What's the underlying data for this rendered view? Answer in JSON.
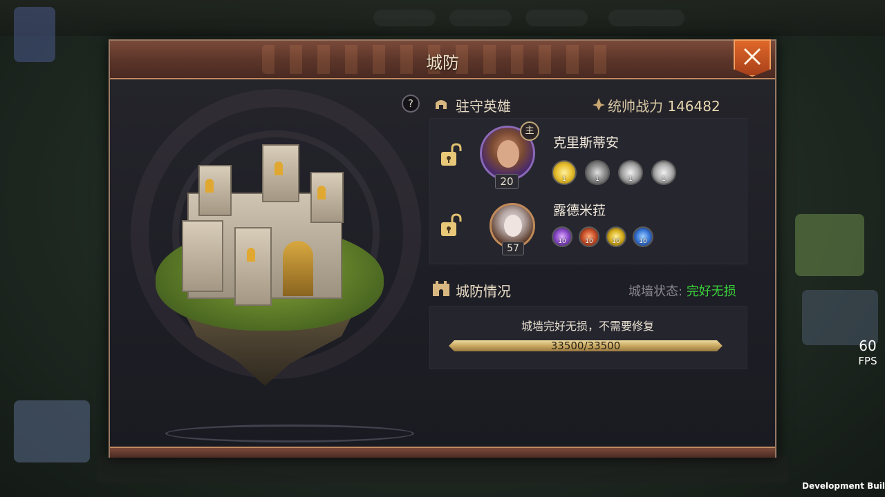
{
  "colors": {
    "accent_orange": "#e0682a",
    "status_green": "#3ad43a",
    "main_hero_frame": "#8a6ab8",
    "hp_gold": "#c8a860"
  },
  "modal": {
    "title": "城防",
    "close_icon": "close-x-icon"
  },
  "garrison": {
    "help_label": "?",
    "title": "驻守英雄",
    "power_label": "统帅战力",
    "power_value": "146482",
    "heroes": [
      {
        "name": "克里斯蒂安",
        "level": "20",
        "main_badge": "主",
        "skills": [
          {
            "icon": "sun-skill-icon",
            "level": "1",
            "color": "#e8c030"
          },
          {
            "icon": "wolf-skill-icon",
            "level": "1",
            "color": "#9a9a9a"
          },
          {
            "icon": "wing-skill-icon",
            "level": "1",
            "color": "#a8a8a8"
          },
          {
            "icon": "crown-skill-icon",
            "level": "1",
            "color": "#b0b0b0"
          }
        ]
      },
      {
        "name": "露德米菈",
        "level": "57",
        "skills": [
          {
            "icon": "arcane-skill-icon",
            "level": "10",
            "color": "#8a4ac8"
          },
          {
            "icon": "fire-skill-icon",
            "level": "10",
            "color": "#c8502a"
          },
          {
            "icon": "holy-skill-icon",
            "level": "10",
            "color": "#d8b020"
          },
          {
            "icon": "frost-skill-icon",
            "level": "10",
            "color": "#3a78d8"
          }
        ]
      }
    ]
  },
  "defense": {
    "title": "城防情况",
    "status_label": "城墙状态:",
    "status_value": "完好无损",
    "message": "城墙完好无损，不需要修复",
    "hp_text": "33500/33500",
    "hp_fraction": 1.0
  },
  "overlay": {
    "fps_value": "60",
    "fps_label": "FPS",
    "dev_build": "Development Build"
  }
}
